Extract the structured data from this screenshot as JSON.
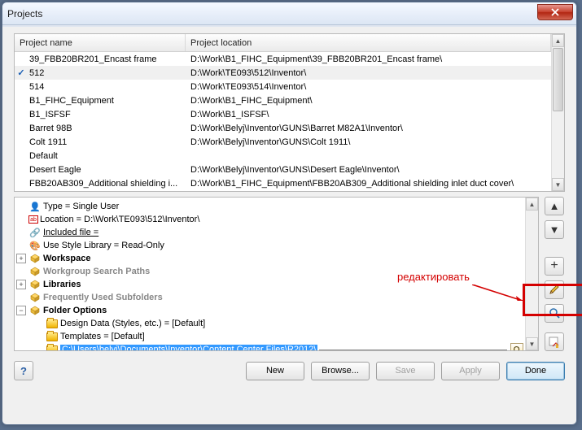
{
  "window": {
    "title": "Projects"
  },
  "columns": {
    "name": "Project name",
    "location": "Project location"
  },
  "projects": [
    {
      "check": "",
      "name": "39_FBB20BR201_Encast frame",
      "loc": "D:\\Work\\B1_FIHC_Equipment\\39_FBB20BR201_Encast frame\\"
    },
    {
      "check": "✓",
      "name": "512",
      "loc": "D:\\Work\\TE093\\512\\Inventor\\"
    },
    {
      "check": "",
      "name": "514",
      "loc": "D:\\Work\\TE093\\514\\Inventor\\"
    },
    {
      "check": "",
      "name": "B1_FIHC_Equipment",
      "loc": "D:\\Work\\B1_FIHC_Equipment\\"
    },
    {
      "check": "",
      "name": "B1_ISFSF",
      "loc": "D:\\Work\\B1_ISFSF\\"
    },
    {
      "check": "",
      "name": "Barret 98B",
      "loc": "D:\\Work\\Belyj\\Inventor\\GUNS\\Barret M82A1\\Inventor\\"
    },
    {
      "check": "",
      "name": "Colt 1911",
      "loc": "D:\\Work\\Belyj\\Inventor\\GUNS\\Colt 1911\\"
    },
    {
      "check": "",
      "name": "Default",
      "loc": ""
    },
    {
      "check": "",
      "name": "Desert Eagle",
      "loc": "D:\\Work\\Belyj\\Inventor\\GUNS\\Desert Eagle\\Inventor\\"
    },
    {
      "check": "",
      "name": "FBB20AB309_Additional shielding i...",
      "loc": "D:\\Work\\B1_FIHC_Equipment\\FBB20AB309_Additional shielding inlet duct cover\\"
    }
  ],
  "tree": {
    "type": "Type = Single User",
    "location": "Location = D:\\Work\\TE093\\512\\Inventor\\",
    "included": "Included file =",
    "style": "Use Style Library = Read-Only",
    "workspace": "Workspace",
    "wsp": "Workgroup Search Paths",
    "libs": "Libraries",
    "fus": "Frequently Used Subfolders",
    "folder_opts": "Folder Options",
    "design": "Design Data (Styles, etc.) = [Default]",
    "templ": "Templates = [Default]",
    "ccf": "C:\\Users\\belyj\\Documents\\Inventor\\Content Center Files\\R2012\\"
  },
  "annotation": "редактировать",
  "buttons": {
    "new": "New",
    "browse": "Browse...",
    "save": "Save",
    "apply": "Apply",
    "done": "Done"
  }
}
